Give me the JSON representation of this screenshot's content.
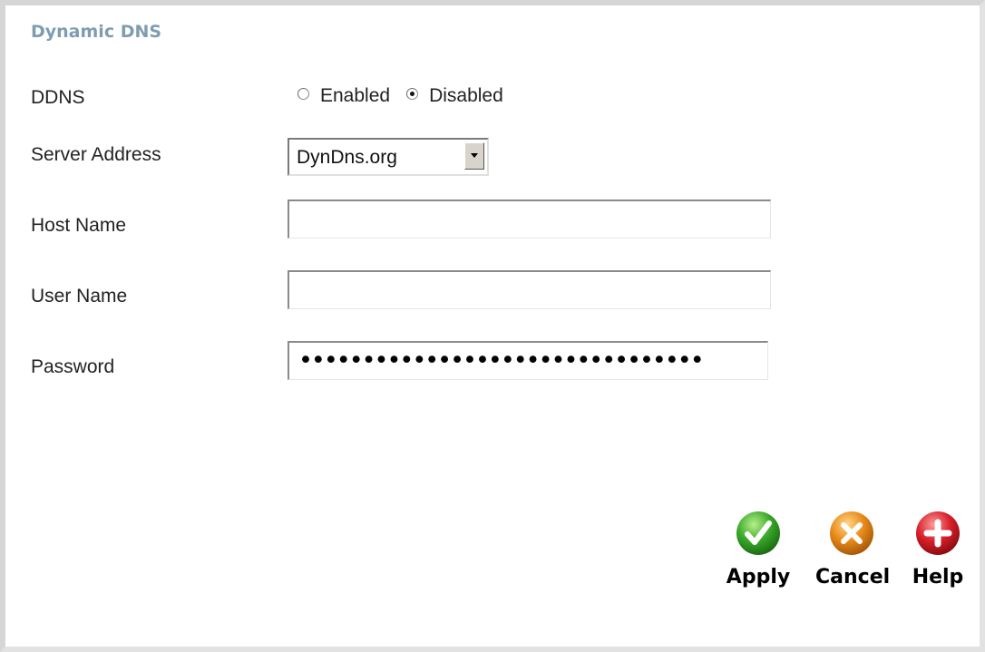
{
  "page": {
    "title": "Dynamic DNS"
  },
  "form": {
    "ddns": {
      "label": "DDNS",
      "options": [
        {
          "label": "Enabled",
          "checked": false
        },
        {
          "label": "Disabled",
          "checked": true
        }
      ]
    },
    "server_address": {
      "label": "Server Address",
      "selected": "DynDns.org"
    },
    "host_name": {
      "label": "Host Name",
      "value": ""
    },
    "user_name": {
      "label": "User Name",
      "value": ""
    },
    "password": {
      "label": "Password",
      "masked_value": "••••••••••••••••••••••••••••••••"
    }
  },
  "actions": {
    "apply": {
      "label": "Apply",
      "icon": "checkmark-icon",
      "color": "#3aa82a"
    },
    "cancel": {
      "label": "Cancel",
      "icon": "x-icon",
      "color": "#e88a1a"
    },
    "help": {
      "label": "Help",
      "icon": "plus-icon",
      "color": "#d8202a"
    }
  }
}
